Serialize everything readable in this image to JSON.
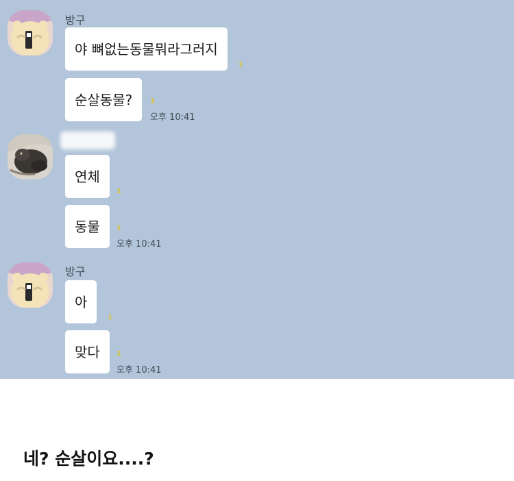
{
  "messages": {
    "group1": {
      "sender": "방구",
      "bubbles": [
        "야 뼈없는동물뭐라그러지",
        "순살동물?"
      ],
      "unread": [
        "1",
        "1"
      ],
      "time": "오후 10:41"
    },
    "group2": {
      "sender": "",
      "bubbles": [
        "연체",
        "동물"
      ],
      "unread": [
        "1",
        "1"
      ],
      "time": "오후 10:41"
    },
    "group3": {
      "sender": "방구",
      "bubbles": [
        "아",
        "맞다"
      ],
      "unread": [
        "1",
        "1"
      ],
      "time": "오후 10:41"
    }
  },
  "caption": "네? 순살이요....?",
  "colors": {
    "chat_background": "#b2c5da",
    "bubble": "#ffffff",
    "unread_count": "#d8c43a",
    "caption_background": "#ffffff"
  },
  "icons": [
    "bear-avatar-icon",
    "cat-avatar-icon"
  ]
}
